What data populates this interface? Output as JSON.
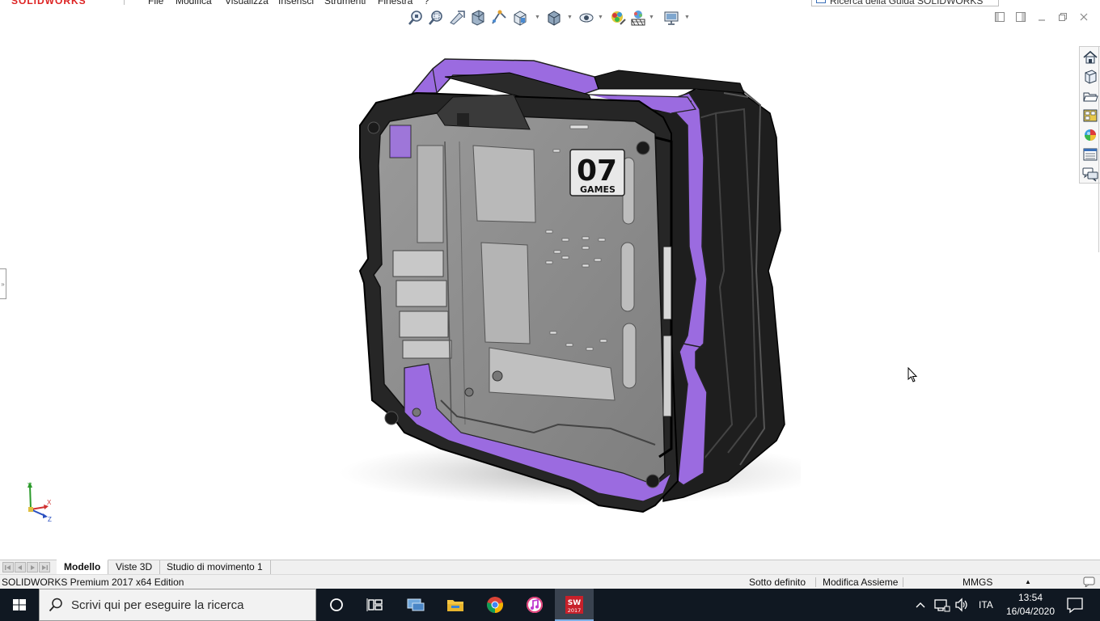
{
  "app": {
    "logo_text": "SOLIDWORKS",
    "menu": [
      "File",
      "Modifica",
      "Visualizza",
      "Inserisci",
      "Strumenti",
      "Finestra",
      "?"
    ],
    "help_search_placeholder": "Ricerca della Guida SOLIDWORKS"
  },
  "hud_toolbar": {
    "icons": [
      "zoom-to-fit-icon",
      "zoom-to-area-icon",
      "previous-view-icon",
      "section-view-icon",
      "dynamic-annotation-icon",
      "view-orientation-icon",
      "display-style-icon",
      "hide-show-items-icon",
      "edit-appearance-icon",
      "apply-scene-icon",
      "view-settings-icon"
    ]
  },
  "task_pane": {
    "icons": [
      "home-icon",
      "design-library-icon",
      "file-explorer-icon",
      "view-palette-icon",
      "appearances-icon",
      "custom-properties-icon",
      "forum-icon"
    ]
  },
  "model": {
    "label_top": "07",
    "label_bottom": "GAMES",
    "accent_color": "#9b6be0",
    "frame_color": "#2a2a2a",
    "panel_color": "#8a8a8a"
  },
  "triad": {
    "x": "X",
    "y": "Y",
    "z": "Z"
  },
  "bottom_tabs": [
    {
      "label": "Modello",
      "active": true
    },
    {
      "label": "Viste 3D",
      "active": false
    },
    {
      "label": "Studio di movimento 1",
      "active": false
    }
  ],
  "status_bar": {
    "edition": "SOLIDWORKS Premium 2017 x64 Edition",
    "definition": "Sotto definito",
    "mode": "Modifica Assieme",
    "units": "MMGS"
  },
  "taskbar": {
    "search_placeholder": "Scrivi qui per eseguire la ricerca",
    "language": "ITA",
    "time": "13:54",
    "date": "16/04/2020",
    "solidworks_badge": "2017"
  }
}
